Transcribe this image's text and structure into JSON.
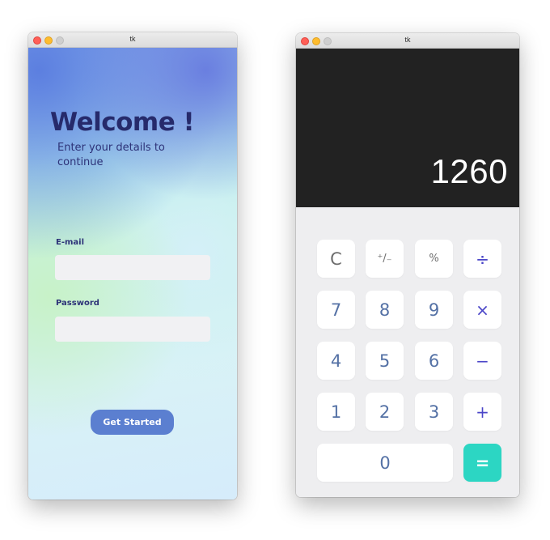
{
  "login_window": {
    "title": "tk",
    "heading": "Welcome !",
    "subtitle": "Enter your details to continue",
    "email_label": "E-mail",
    "email_value": "",
    "password_label": "Password",
    "password_value": "",
    "submit_label": "Get Started"
  },
  "calculator_window": {
    "title": "tk",
    "display": "1260",
    "keys": {
      "clear": "C",
      "sign": "⁺/₋",
      "percent": "%",
      "divide": "÷",
      "seven": "7",
      "eight": "8",
      "nine": "9",
      "multiply": "×",
      "four": "4",
      "five": "5",
      "six": "6",
      "minus": "−",
      "one": "1",
      "two": "2",
      "three": "3",
      "plus": "+",
      "zero": "0",
      "equals": "="
    }
  },
  "colors": {
    "accent_button": "#5b7fd0",
    "equals_key": "#2cd6c3",
    "display_bg": "#222222",
    "heading_text": "#262a6b"
  }
}
